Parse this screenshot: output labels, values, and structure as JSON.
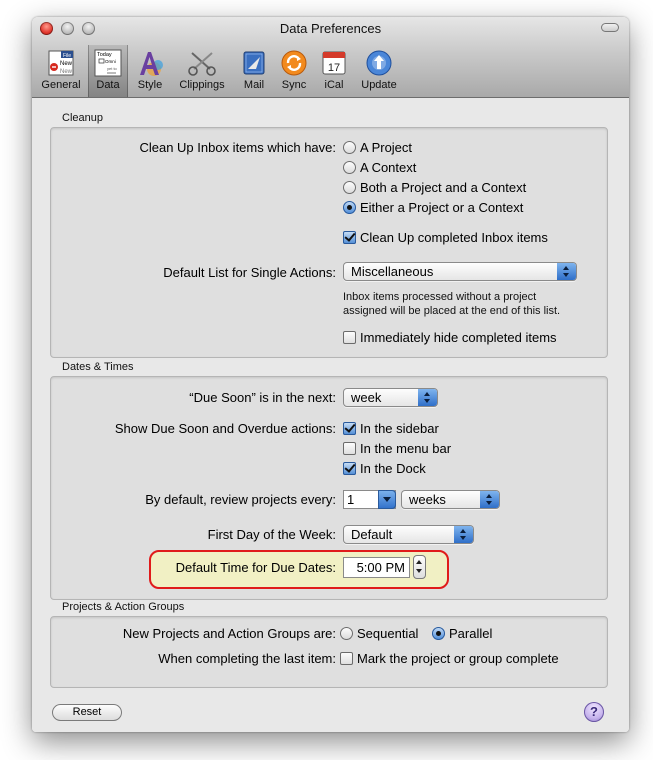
{
  "window": {
    "title": "Data Preferences"
  },
  "toolbar": {
    "items": [
      {
        "label": "General",
        "icon": "general-icon"
      },
      {
        "label": "Data",
        "icon": "data-icon"
      },
      {
        "label": "Style",
        "icon": "style-icon"
      },
      {
        "label": "Clippings",
        "icon": "clippings-icon"
      },
      {
        "label": "Mail",
        "icon": "mail-icon"
      },
      {
        "label": "Sync",
        "icon": "sync-icon"
      },
      {
        "label": "iCal",
        "icon": "ical-icon"
      },
      {
        "label": "Update",
        "icon": "update-icon"
      }
    ],
    "selected": "Data",
    "general_icon_text": [
      "File",
      "New",
      "New"
    ],
    "data_icon_text": [
      "Today",
      "Omni",
      "yet to"
    ],
    "ical_day": "17"
  },
  "cleanup": {
    "title": "Cleanup",
    "clean_label": "Clean Up Inbox items which have:",
    "options": [
      "A Project",
      "A Context",
      "Both a Project and a Context",
      "Either a Project or a Context"
    ],
    "selected_option": "Either a Project or a Context",
    "completed_label": "Clean Up completed Inbox items",
    "completed_checked": true,
    "default_list_label": "Default List for Single Actions:",
    "default_list_value": "Miscellaneous",
    "note_line1": "Inbox items processed without a project",
    "note_line2": "assigned will be placed at the end of this list.",
    "hide_label": "Immediately hide completed items",
    "hide_checked": false
  },
  "dates": {
    "title": "Dates & Times",
    "due_soon_label": "“Due Soon” is in the next:",
    "due_soon_value": "week",
    "show_label": "Show Due Soon and Overdue actions:",
    "show_sidebar": "In the sidebar",
    "show_menubar": "In the menu bar",
    "show_dock": "In the Dock",
    "sidebar_checked": true,
    "menubar_checked": false,
    "dock_checked": true,
    "review_label": "By default, review projects every:",
    "review_count": "1",
    "review_unit": "weeks",
    "first_day_label": "First Day of the Week:",
    "first_day_value": "Default",
    "default_time_label": "Default Time for Due Dates:",
    "default_time_value": "5:00 PM"
  },
  "projects": {
    "title": "Projects & Action Groups",
    "new_label": "New Projects and Action Groups are:",
    "sequential": "Sequential",
    "parallel": "Parallel",
    "selected": "Parallel",
    "completing_label": "When completing the last item:",
    "mark_label": "Mark the project or group complete",
    "mark_checked": false
  },
  "footer": {
    "reset_label": "Reset",
    "help_glyph": "?"
  },
  "colors": {
    "highlight_border": "#e01b1b",
    "highlight_fill": "#f1f0c4",
    "accent_blue": "#2f6fc9"
  }
}
